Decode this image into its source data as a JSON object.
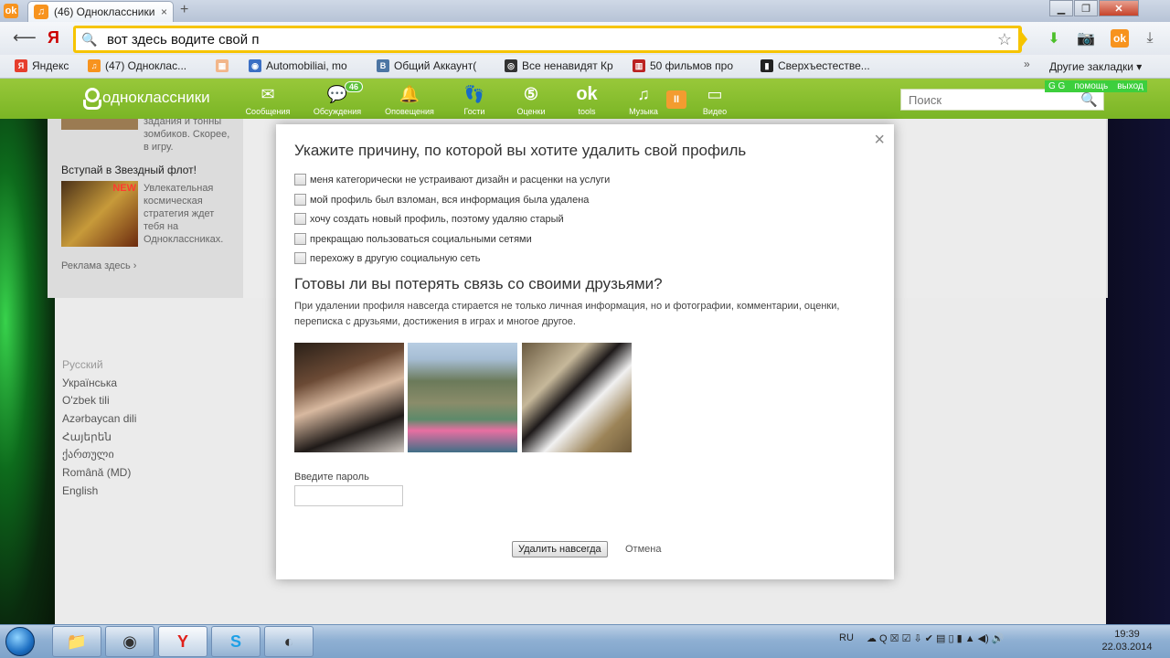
{
  "browser": {
    "tab_title": "(46) Одноклассники",
    "address_text": "вот здесь водите свой п",
    "bookmarks": [
      "Яндекс",
      "(47) Одноклас...",
      "",
      "Automobiliai, mo",
      "Общий Аккаунт(",
      "Все ненавидят Кр",
      "50 фильмов про",
      "Сверхъестестве..."
    ],
    "other_bookmarks": "Другие закладки ▾",
    "new_tab": "+"
  },
  "site": {
    "logo_text": "одноклассники",
    "nav": [
      {
        "label": "Сообщения",
        "icon": "envelope-icon",
        "glyph": "✉"
      },
      {
        "label": "Обсуждения",
        "icon": "chat-icon",
        "glyph": "💬",
        "badge": "46"
      },
      {
        "label": "Оповещения",
        "icon": "bell-icon",
        "glyph": "🔔"
      },
      {
        "label": "Гости",
        "icon": "footprints-icon",
        "glyph": "👣"
      },
      {
        "label": "Оценки",
        "icon": "rating-icon",
        "glyph": "5"
      },
      {
        "label": "tools",
        "icon": "ok-tools-icon",
        "glyph": "ok"
      },
      {
        "label": "Музыка",
        "icon": "music-icon",
        "glyph": "♫"
      },
      {
        "label": "Видео",
        "icon": "video-icon",
        "glyph": "▭"
      }
    ],
    "search_placeholder": "Поиск",
    "gg_links": [
      "G G",
      "помощь",
      "выход"
    ]
  },
  "sidebar": {
    "promo1_text": "зомбиков. Скорее,\nв игру.",
    "promo1_partial": "задания и тонны",
    "promo2_title": "Вступай в Звездный флот!",
    "promo2_badge": "NEW",
    "promo2_text": "Увлекательная\nкосмическая\nстратегия ждет\nтебя на\nОдноклассниках.",
    "ads_link": "Реклама здесь ›",
    "languages": [
      "Русский",
      "Українська",
      "O'zbek tili",
      "Azərbaycan dili",
      "Հայերեն",
      "ქართული",
      "Română (MD)",
      "English"
    ]
  },
  "modal": {
    "title": "Укажите причину, по которой вы хотите удалить свой профиль",
    "reasons": [
      "меня категорически не устраивают дизайн и расценки на услуги",
      "мой профиль был взломан, вся информация была удалена",
      "хочу создать новый профиль, поэтому удаляю старый",
      "прекращаю пользоваться социальными сетями",
      "перехожу в другую социальную сеть"
    ],
    "subtitle": "Готовы ли вы потерять связь со своими друзьями?",
    "warning": "При удалении профиля навсегда стирается не только личная информация, но и фотографии, комментарии, оценки, переписка с друзьями, достижения в играх и многое другое.",
    "password_label": "Введите пароль",
    "delete_button": "Удалить навсегда",
    "cancel_link": "Отмена",
    "close": "×"
  },
  "taskbar": {
    "lang": "RU",
    "time": "19:39",
    "date": "22.03.2014"
  },
  "colors": {
    "site_green": "#8bbf2f",
    "address_border": "#f6c400",
    "ok_orange": "#f7931e"
  }
}
